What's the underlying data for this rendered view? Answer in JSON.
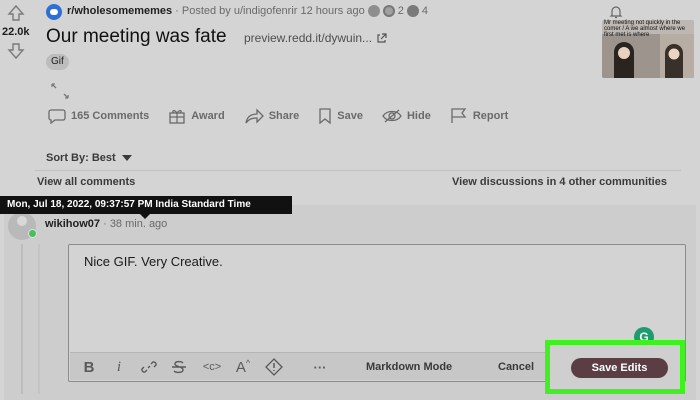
{
  "post": {
    "score": "22.0k",
    "subreddit": "r/wholesomememes",
    "posted_by": "· Posted by u/indigofenrir 12 hours ago",
    "award_count_2": "2",
    "award_count_3": "4",
    "title": "Our meeting was fate",
    "link_text": "preview.redd.it/dywuin...",
    "flair": "Gif",
    "thumbnail_caption": "Mr meeting not quickly in the comer / A we almost where we first met is where"
  },
  "actions": {
    "comments": "165 Comments",
    "award": "Award",
    "share": "Share",
    "save": "Save",
    "hide": "Hide",
    "report": "Report"
  },
  "sort": {
    "label": "Sort By: Best"
  },
  "comments_bar": {
    "view_all": "View all comments",
    "view_discussions": "View discussions in 4 other communities"
  },
  "tooltip": {
    "text": "Mon, Jul 18, 2022, 09:37:57 PM India Standard Time"
  },
  "comment": {
    "username": "wikihow07",
    "time": "· 38 min. ago",
    "text": "Nice GIF. Very Creative."
  },
  "editor_toolbar": {
    "bold": "B",
    "italic": "i",
    "code": "<c>",
    "superscript": "A",
    "more": "···",
    "markdown_mode": "Markdown Mode",
    "cancel": "Cancel",
    "save_edits": "Save Edits"
  },
  "grammarly": {
    "label": "G"
  },
  "colors": {
    "save_button": "#5b3e44",
    "highlight": "#3ff21f",
    "online": "#46c05a",
    "subreddit_icon": "#2d6fd9"
  }
}
